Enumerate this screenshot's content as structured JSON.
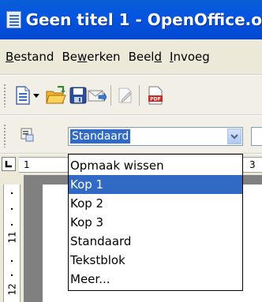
{
  "window": {
    "title": "Geen titel 1 - OpenOffice.o"
  },
  "menu": [
    {
      "pre": "",
      "ul": "B",
      "post": "estand"
    },
    {
      "pre": "Be",
      "ul": "w",
      "post": "erken"
    },
    {
      "pre": "Beel",
      "ul": "d",
      "post": ""
    },
    {
      "pre": "",
      "ul": "I",
      "post": "nvoeg"
    }
  ],
  "toolbar": {
    "icons": [
      "new-document-icon",
      "dropdown-arrow-icon",
      "open-folder-icon",
      "save-icon",
      "email-icon",
      "edit-file-icon",
      "export-pdf-icon"
    ]
  },
  "formatbar": {
    "styles_icon": "styles-icon",
    "style_value": "Standaard"
  },
  "ruler": {
    "h_numbers": [
      "1",
      "3"
    ],
    "v_numbers": [
      "11",
      "12"
    ]
  },
  "dropdown": {
    "items": [
      "Opmaak wissen",
      "Kop 1",
      "Kop 2",
      "Kop 3",
      "Standaard",
      "Tekstblok",
      "Meer..."
    ],
    "selected_index": 1
  },
  "colors": {
    "titlebar": "#0454e0",
    "selection": "#316ac5",
    "chrome": "#ece9d8"
  }
}
